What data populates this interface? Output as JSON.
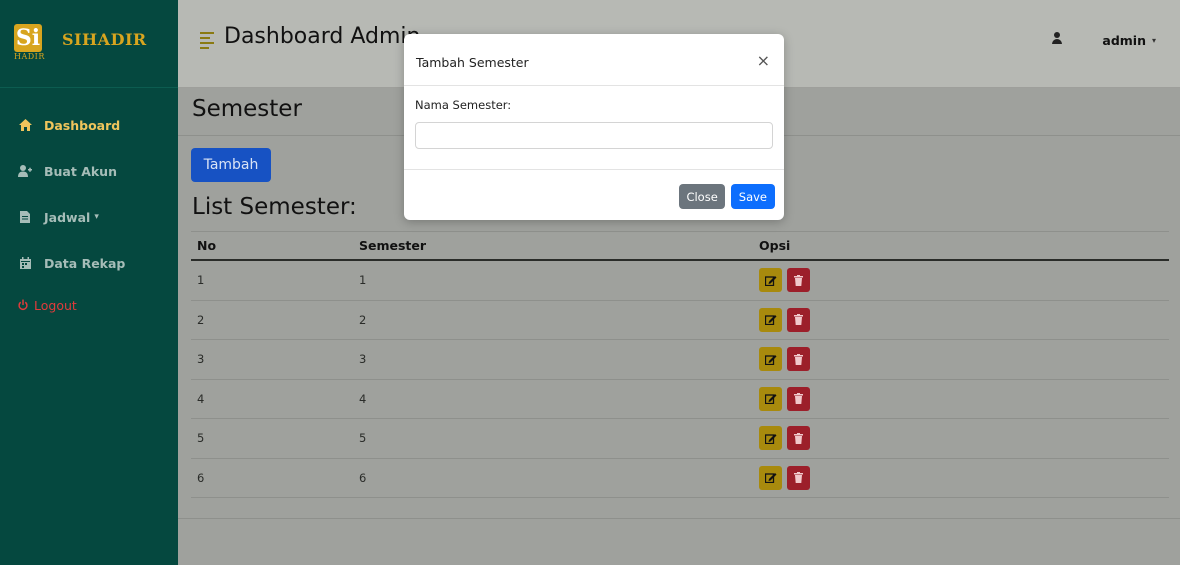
{
  "brand": {
    "logo_text": "Si",
    "logo_sub": "HADIR",
    "title": "SIHADIR"
  },
  "sidebar": {
    "items": [
      {
        "label": "Dashboard",
        "icon": "home-icon"
      },
      {
        "label": "Buat Akun",
        "icon": "user-plus-icon"
      },
      {
        "label": "Jadwal",
        "icon": "file-icon",
        "caret": "▾"
      },
      {
        "label": "Data Rekap",
        "icon": "calendar-icon"
      },
      {
        "label": "Logout",
        "icon": "power-icon"
      }
    ]
  },
  "topbar": {
    "title": "Dashboard Admin",
    "user": "admin",
    "caret": "▾"
  },
  "main": {
    "section_title": "Semester",
    "add_button": "Tambah",
    "list_title": "List Semester:",
    "table": {
      "columns": [
        "No",
        "Semester",
        "Opsi"
      ],
      "rows": [
        {
          "no": "1",
          "semester": "1"
        },
        {
          "no": "2",
          "semester": "2"
        },
        {
          "no": "3",
          "semester": "3"
        },
        {
          "no": "4",
          "semester": "4"
        },
        {
          "no": "5",
          "semester": "5"
        },
        {
          "no": "6",
          "semester": "6"
        }
      ]
    }
  },
  "modal": {
    "title": "Tambah Semester",
    "close_symbol": "×",
    "field_label": "Nama Semester:",
    "field_value": "",
    "field_placeholder": "",
    "close_button": "Close",
    "save_button": "Save"
  },
  "colors": {
    "sidebar": "#05483f",
    "brand_gold": "#d8a51f",
    "primary": "#1752c3",
    "edit": "#a88a0d",
    "delete": "#9c1f2a"
  }
}
